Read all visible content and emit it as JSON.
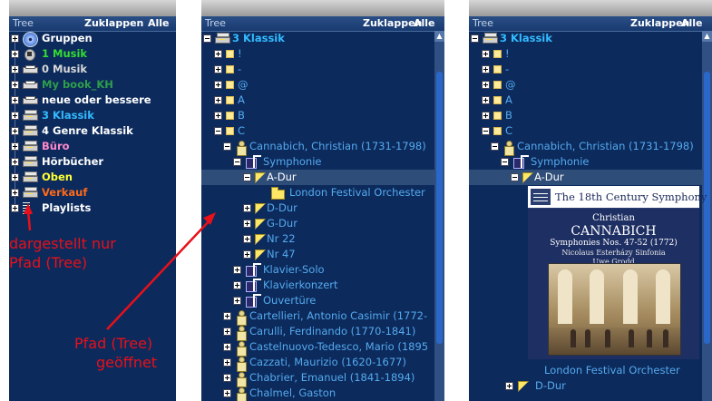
{
  "header": {
    "title": "Tree",
    "collapse": "Zuklappen",
    "all": "Alle"
  },
  "panel_left": {
    "items": [
      {
        "label": "Gruppen",
        "icon": "cd-icon",
        "color": "#ffffff"
      },
      {
        "label": "1 Musik",
        "icon": "music-icon",
        "color": "#33dd33"
      },
      {
        "label": "0 Musik",
        "icon": "disk-icon",
        "color": "#d8d8d8"
      },
      {
        "label": "My book_KH",
        "icon": "disk-icon",
        "color": "#2f9e4a"
      },
      {
        "label": "neue oder bessere",
        "icon": "disk-icon",
        "color": "#ffffff"
      },
      {
        "label": "3 Klassik",
        "icon": "server-icon",
        "color": "#33bbff"
      },
      {
        "label": "4 Genre Klassik",
        "icon": "server-icon",
        "color": "#ffffff"
      },
      {
        "label": "Büro",
        "icon": "server-icon",
        "color": "#ff88cc"
      },
      {
        "label": "Hörbücher",
        "icon": "server-icon",
        "color": "#ffffff"
      },
      {
        "label": "Oben",
        "icon": "server-icon",
        "color": "#ffff33"
      },
      {
        "label": "Verkauf",
        "icon": "server-icon",
        "color": "#ff6a1a"
      },
      {
        "label": "Playlists",
        "icon": "list-icon",
        "color": "#ffffff"
      }
    ]
  },
  "panel_mid": {
    "items": [
      {
        "label": "3 Klassik",
        "icon": "server-icon",
        "level": 0,
        "toggle": "minus",
        "bold": true,
        "color": "#33bbff"
      },
      {
        "label": "!",
        "icon": "square-icon",
        "level": 1,
        "toggle": "plus",
        "color": "#55aaee"
      },
      {
        "label": "-",
        "icon": "square-icon",
        "level": 1,
        "toggle": "plus",
        "color": "#55aaee"
      },
      {
        "label": "@",
        "icon": "square-icon",
        "level": 1,
        "toggle": "plus",
        "color": "#55aaee"
      },
      {
        "label": "A",
        "icon": "square-icon",
        "level": 1,
        "toggle": "plus",
        "color": "#55aaee"
      },
      {
        "label": "B",
        "icon": "square-icon",
        "level": 1,
        "toggle": "plus",
        "color": "#55aaee"
      },
      {
        "label": "C",
        "icon": "square-icon",
        "level": 1,
        "toggle": "minus",
        "color": "#55aaee"
      },
      {
        "label": "Cannabich, Christian (1731-1798)",
        "icon": "person-icon",
        "level": 2,
        "toggle": "minus",
        "color": "#55aaee"
      },
      {
        "label": "Symphonie",
        "icon": "note-icon",
        "level": 3,
        "toggle": "minus",
        "color": "#55aaee"
      },
      {
        "label": "A-Dur",
        "icon": "flag-icon",
        "level": 4,
        "toggle": "minus",
        "selected": true,
        "color": "#ffffff"
      },
      {
        "label": "London Festival Orchester",
        "icon": "folder-icon",
        "level": 5,
        "toggle": "none",
        "color": "#55aaee"
      },
      {
        "label": "D-Dur",
        "icon": "flag-icon",
        "level": 4,
        "toggle": "plus",
        "color": "#55aaee"
      },
      {
        "label": "G-Dur",
        "icon": "flag-icon",
        "level": 4,
        "toggle": "plus",
        "color": "#55aaee"
      },
      {
        "label": "Nr 22",
        "icon": "flag-icon",
        "level": 4,
        "toggle": "plus",
        "color": "#55aaee"
      },
      {
        "label": "Nr 47",
        "icon": "flag-icon",
        "level": 4,
        "toggle": "plus",
        "color": "#55aaee"
      },
      {
        "label": "Klavier-Solo",
        "icon": "note-icon",
        "level": 3,
        "toggle": "plus",
        "color": "#55aaee"
      },
      {
        "label": "Klavierkonzert",
        "icon": "note-icon",
        "level": 3,
        "toggle": "plus",
        "color": "#55aaee"
      },
      {
        "label": "Ouvertüre",
        "icon": "note-icon",
        "level": 3,
        "toggle": "plus",
        "color": "#55aaee"
      },
      {
        "label": "Cartellieri, Antonio Casimir (1772-",
        "icon": "person-icon",
        "level": 2,
        "toggle": "plus",
        "color": "#55aaee"
      },
      {
        "label": "Carulli, Ferdinando (1770-1841)",
        "icon": "person-icon",
        "level": 2,
        "toggle": "plus",
        "color": "#55aaee"
      },
      {
        "label": "Castelnuovo-Tedesco, Mario (1895",
        "icon": "person-icon",
        "level": 2,
        "toggle": "plus",
        "color": "#55aaee"
      },
      {
        "label": "Cazzati, Maurizio (1620-1677)",
        "icon": "person-icon",
        "level": 2,
        "toggle": "plus",
        "color": "#55aaee"
      },
      {
        "label": "Chabrier, Emanuel (1841-1894)",
        "icon": "person-icon",
        "level": 2,
        "toggle": "plus",
        "color": "#55aaee"
      },
      {
        "label": "Chalmel, Gaston",
        "icon": "person-icon",
        "level": 2,
        "toggle": "plus",
        "color": "#55aaee"
      }
    ]
  },
  "panel_right": {
    "items": [
      {
        "label": "3 Klassik",
        "icon": "server-icon",
        "level": 0,
        "toggle": "minus",
        "bold": true,
        "color": "#33bbff"
      },
      {
        "label": "!",
        "icon": "square-icon",
        "level": 1,
        "toggle": "plus",
        "color": "#55aaee"
      },
      {
        "label": "-",
        "icon": "square-icon",
        "level": 1,
        "toggle": "plus",
        "color": "#55aaee"
      },
      {
        "label": "@",
        "icon": "square-icon",
        "level": 1,
        "toggle": "plus",
        "color": "#55aaee"
      },
      {
        "label": "A",
        "icon": "square-icon",
        "level": 1,
        "toggle": "plus",
        "color": "#55aaee"
      },
      {
        "label": "B",
        "icon": "square-icon",
        "level": 1,
        "toggle": "plus",
        "color": "#55aaee"
      },
      {
        "label": "C",
        "icon": "square-icon",
        "level": 1,
        "toggle": "minus",
        "color": "#55aaee"
      },
      {
        "label": "Cannabich, Christian (1731-1798)",
        "icon": "person-icon",
        "level": 2,
        "toggle": "minus",
        "color": "#55aaee"
      },
      {
        "label": "Symphonie",
        "icon": "note-icon",
        "level": 3,
        "toggle": "minus",
        "color": "#55aaee"
      },
      {
        "label": "A-Dur",
        "icon": "flag-icon",
        "level": 4,
        "toggle": "minus",
        "selected": true,
        "color": "#ffffff"
      }
    ],
    "after_cover": [
      {
        "label": "London Festival Orchester",
        "color": "#55aaee"
      },
      {
        "label": "D-Dur",
        "icon": "flag-icon",
        "color": "#55aaee"
      }
    ]
  },
  "album": {
    "series": "The 18th Century Symphony",
    "composer_first": "Christian",
    "composer_last": "CANNABICH",
    "works": "Symphonies Nos. 47-52 (1772)",
    "ensemble": "Nicolaus Esterházy Sinfonia",
    "conductor": "Uwe Grodd"
  },
  "annotations": {
    "left_line1": "dargestellt nur",
    "left_line2": "Pfad (Tree)",
    "mid_line1": "Pfad (Tree)",
    "mid_line2": "geöffnet"
  },
  "colors": {
    "panel_bg": "#0c2a5c",
    "link": "#55aaee",
    "annotation": "#e8101a"
  }
}
